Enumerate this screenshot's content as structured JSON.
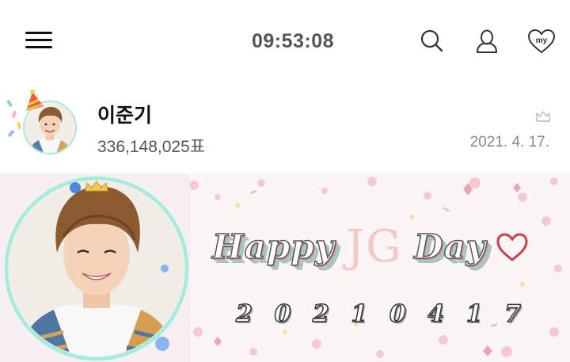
{
  "header": {
    "clock": "09:53:08",
    "icons": {
      "menu": "hamburger-menu-icon",
      "search": "search-icon",
      "profile": "user-icon",
      "my": "heart-my-icon"
    },
    "my_label": "my"
  },
  "profile": {
    "name": "이준기",
    "votes": "336,148,025표",
    "date": "2021. 4. 17.",
    "badge_icon": "crown-icon"
  },
  "banner": {
    "headline": {
      "word1": "Happy",
      "accent": "JG",
      "word2": "Day"
    },
    "date_digits": [
      "2",
      "0",
      "2",
      "1",
      "0",
      "4",
      "1",
      "7"
    ],
    "colors": {
      "ring": "#a8eadc",
      "heart": "#c9404f",
      "accent_pink": "#f2c9c5"
    }
  }
}
